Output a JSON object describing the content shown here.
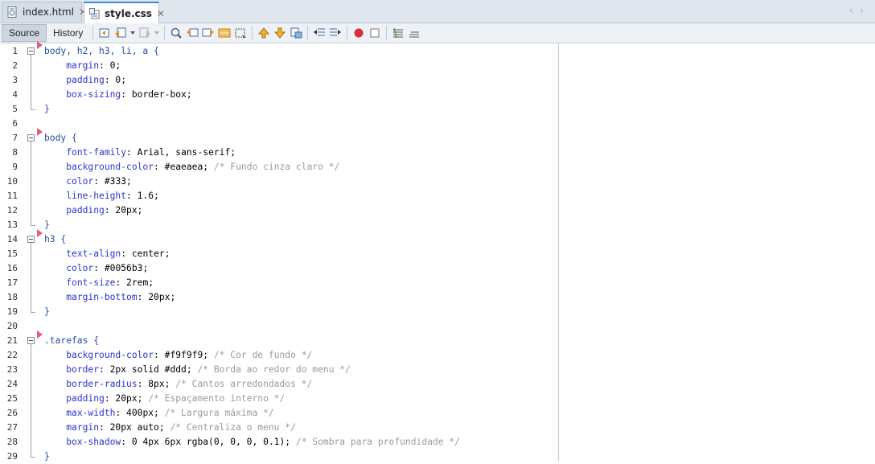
{
  "tabs": [
    {
      "label": "index.html",
      "icon": "html-file-icon",
      "active": false
    },
    {
      "label": "style.css",
      "icon": "css-file-icon",
      "active": true
    }
  ],
  "toolbar": {
    "source_label": "Source",
    "history_label": "History"
  },
  "colors": {
    "selector": "#1f4f9f",
    "property": "#2a35cc",
    "comment": "#9a9a9a",
    "accent": "#3a8ad8"
  },
  "lines": [
    {
      "n": "1",
      "sel": "body, h2, h3, li, a {",
      "prop": "",
      "val": "",
      "cmt": ""
    },
    {
      "n": "2",
      "sel": "",
      "prop": "margin",
      "val": ": 0;",
      "cmt": ""
    },
    {
      "n": "3",
      "sel": "",
      "prop": "padding",
      "val": ": 0;",
      "cmt": ""
    },
    {
      "n": "4",
      "sel": "",
      "prop": "box-sizing",
      "val": ": border-box;",
      "cmt": ""
    },
    {
      "n": "5",
      "sel": "}",
      "prop": "",
      "val": "",
      "cmt": ""
    },
    {
      "n": "6",
      "sel": "",
      "prop": "",
      "val": "",
      "cmt": ""
    },
    {
      "n": "7",
      "sel": "body {",
      "prop": "",
      "val": "",
      "cmt": ""
    },
    {
      "n": "8",
      "sel": "",
      "prop": "font-family",
      "val": ": Arial, sans-serif;",
      "cmt": ""
    },
    {
      "n": "9",
      "sel": "",
      "prop": "background-color",
      "val": ": #eaeaea; ",
      "cmt": "/* Fundo cinza claro */"
    },
    {
      "n": "10",
      "sel": "",
      "prop": "color",
      "val": ": #333;",
      "cmt": ""
    },
    {
      "n": "11",
      "sel": "",
      "prop": "line-height",
      "val": ": 1.6;",
      "cmt": ""
    },
    {
      "n": "12",
      "sel": "",
      "prop": "padding",
      "val": ": 20px;",
      "cmt": ""
    },
    {
      "n": "13",
      "sel": "}",
      "prop": "",
      "val": "",
      "cmt": ""
    },
    {
      "n": "14",
      "sel": "h3 {",
      "prop": "",
      "val": "",
      "cmt": ""
    },
    {
      "n": "15",
      "sel": "",
      "prop": "text-align",
      "val": ": center;",
      "cmt": ""
    },
    {
      "n": "16",
      "sel": "",
      "prop": "color",
      "val": ": #0056b3;",
      "cmt": ""
    },
    {
      "n": "17",
      "sel": "",
      "prop": "font-size",
      "val": ": 2rem;",
      "cmt": ""
    },
    {
      "n": "18",
      "sel": "",
      "prop": "margin-bottom",
      "val": ": 20px;",
      "cmt": ""
    },
    {
      "n": "19",
      "sel": "}",
      "prop": "",
      "val": "",
      "cmt": ""
    },
    {
      "n": "20",
      "sel": "",
      "prop": "",
      "val": "",
      "cmt": ""
    },
    {
      "n": "21",
      "sel": ".tarefas {",
      "prop": "",
      "val": "",
      "cmt": ""
    },
    {
      "n": "22",
      "sel": "",
      "prop": "background-color",
      "val": ": #f9f9f9; ",
      "cmt": "/* Cor de fundo */"
    },
    {
      "n": "23",
      "sel": "",
      "prop": "border",
      "val": ": 2px solid #ddd; ",
      "cmt": "/* Borda ao redor do menu */"
    },
    {
      "n": "24",
      "sel": "",
      "prop": "border-radius",
      "val": ": 8px; ",
      "cmt": "/* Cantos arredondados */"
    },
    {
      "n": "25",
      "sel": "",
      "prop": "padding",
      "val": ": 20px; ",
      "cmt": "/* Espaçamento interno */"
    },
    {
      "n": "26",
      "sel": "",
      "prop": "max-width",
      "val": ": 400px; ",
      "cmt": "/* Largura máxima */"
    },
    {
      "n": "27",
      "sel": "",
      "prop": "margin",
      "val": ": 20px auto; ",
      "cmt": "/* Centraliza o menu */"
    },
    {
      "n": "28",
      "sel": "",
      "prop": "box-shadow",
      "val": ": 0 4px 6px rgba(0, 0, 0, 0.1); ",
      "cmt": "/* Sombra para profundidade */"
    },
    {
      "n": "29",
      "sel": "}",
      "prop": "",
      "val": "",
      "cmt": ""
    }
  ]
}
